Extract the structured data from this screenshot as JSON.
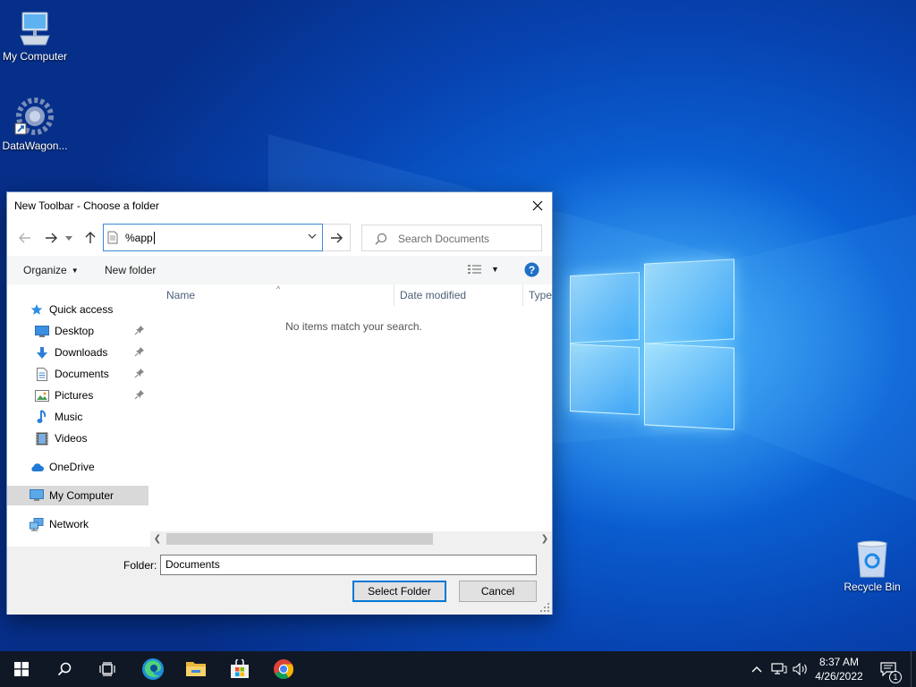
{
  "desktop": {
    "icons": [
      {
        "label": "My Computer",
        "icon": "computer-icon"
      },
      {
        "label": "DataWagon...",
        "icon": "gear-app-icon"
      },
      {
        "label": "Recycle Bin",
        "icon": "recycle-bin-icon"
      }
    ]
  },
  "dialog": {
    "title": "New Toolbar - Choose a folder",
    "address_value": "%app",
    "search_placeholder": "Search Documents",
    "commands": {
      "organize": "Organize",
      "new_folder": "New folder"
    },
    "nav": {
      "quick_access": "Quick access",
      "items": [
        {
          "label": "Desktop",
          "pinned": true,
          "icon": "desktop-icon"
        },
        {
          "label": "Downloads",
          "pinned": true,
          "icon": "downloads-icon"
        },
        {
          "label": "Documents",
          "pinned": true,
          "icon": "documents-icon"
        },
        {
          "label": "Pictures",
          "pinned": true,
          "icon": "pictures-icon"
        },
        {
          "label": "Music",
          "pinned": false,
          "icon": "music-icon"
        },
        {
          "label": "Videos",
          "pinned": false,
          "icon": "videos-icon"
        }
      ],
      "onedrive": "OneDrive",
      "my_computer": "My Computer",
      "network": "Network"
    },
    "columns": {
      "name": "Name",
      "date_modified": "Date modified",
      "type": "Type"
    },
    "empty_message": "No items match your search.",
    "folder_label": "Folder:",
    "folder_value": "Documents",
    "select_button": "Select Folder",
    "cancel_button": "Cancel"
  },
  "taskbar": {
    "time": "8:37 AM",
    "date": "4/26/2022",
    "notification_count": "1",
    "pinned": [
      "start-icon",
      "search-icon",
      "task-view-icon",
      "edge-icon",
      "file-explorer-icon",
      "store-icon",
      "chrome-icon"
    ]
  },
  "colors": {
    "accent": "#0078d7",
    "taskbar": "#101826",
    "wallpaper": "#0b63d6"
  }
}
